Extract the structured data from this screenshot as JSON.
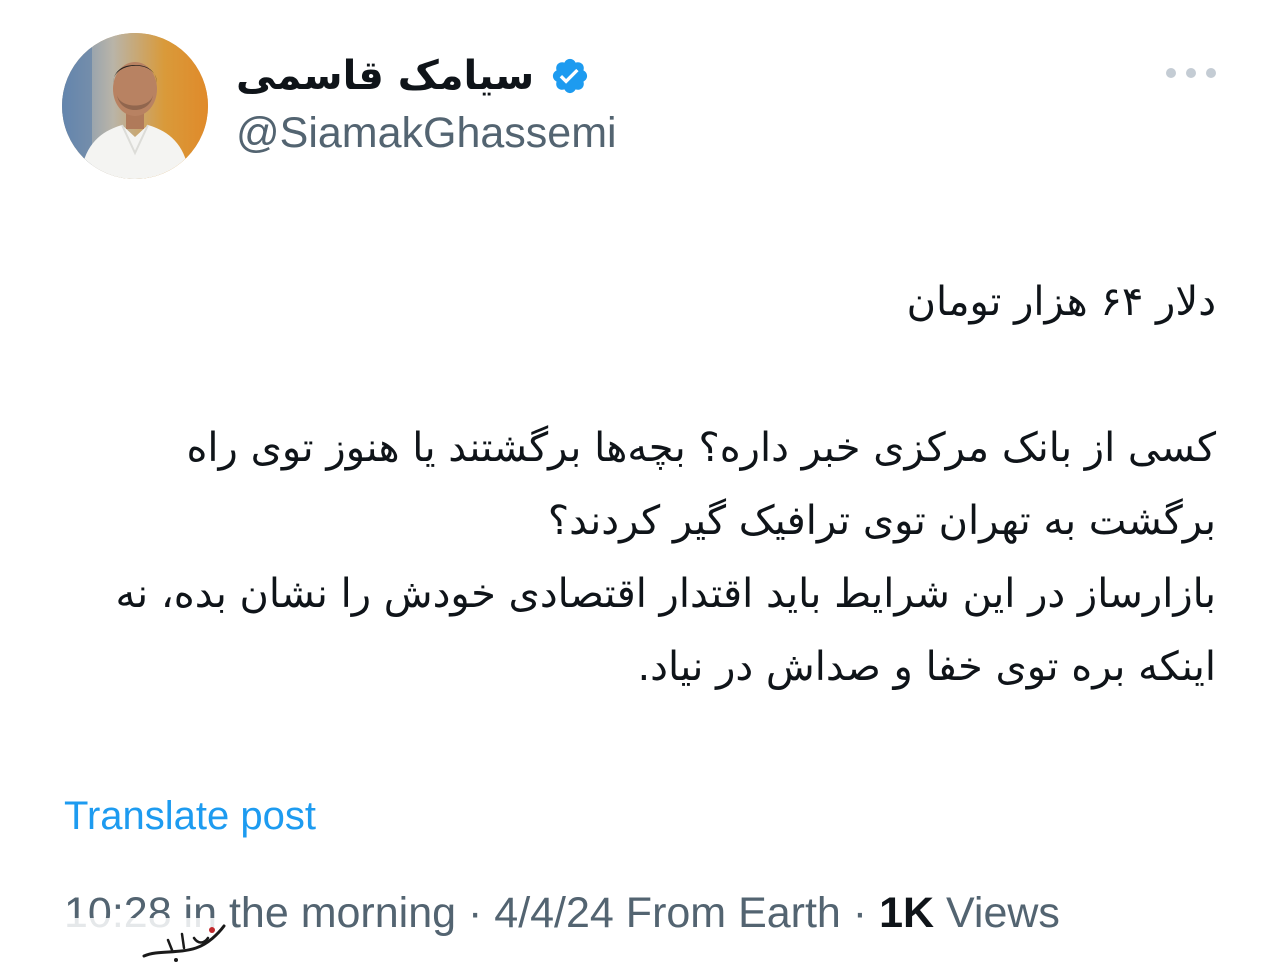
{
  "user": {
    "display_name": "سیامک قاسمی",
    "handle": "@SiamakGhassemi",
    "verified_icon": "verified-badge-icon",
    "avatar_icon": "profile-photo"
  },
  "more_icon": "more-dots-icon",
  "tweet": {
    "line1": "دلار ۶۴ هزار تومان",
    "paragraph2": "کسی از بانک مرکزی خبر داره؟ بچه‌ها برگشتند یا هنوز توی راه برگشت به تهران توی ترافیک گیر کردند؟",
    "paragraph3": "بازارساز در این شرایط باید اقتدار اقتصادی خودش را نشان بده، نه اینکه بره توی خفا و صداش در نیاد."
  },
  "translate_label": "Translate post",
  "meta": {
    "time": "10:28 in the morning",
    "separator": "·",
    "date": "4/4/24",
    "source": "From Earth",
    "views_count": "1K",
    "views_label": "Views"
  },
  "colors": {
    "link_blue": "#1d9bf0",
    "text_primary": "#0f1419",
    "text_secondary": "#536471",
    "verified_blue": "#1d9bf0"
  },
  "watermark": {
    "text": "تابناک"
  }
}
